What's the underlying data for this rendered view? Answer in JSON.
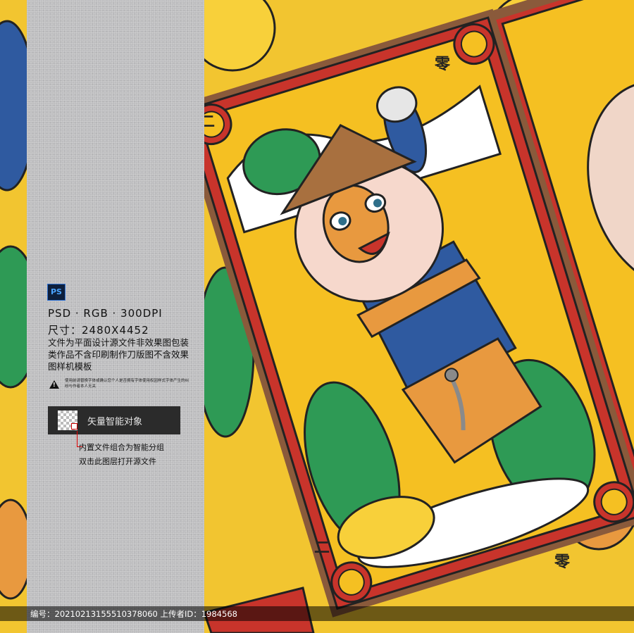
{
  "panel": {
    "format_icon": "PS",
    "spec_line": "PSD · RGB · 300DPI",
    "size_line": "尺寸：2480X4452",
    "description": "文件为平面设计源文件非效果图包装类作品不含印刷制作刀版图不含效果图样机模板",
    "warning": "使用前请替换字体或确认您个人是否拥有字体使用权因样式字体产生的纠纷与作者本人无关",
    "smart_object_label": "矢量智能对象",
    "note_line1": "内置文件组合为智能分组",
    "note_line2": "双击此图层打开源文件"
  },
  "footer": {
    "text": "编号：20210213155510378060 上传者ID：1984568"
  },
  "artwork": {
    "card_top_seal": "零",
    "card_left_seal": "二",
    "card_bottom_seal": "二",
    "card_bottom_right_seal": "零",
    "colors": {
      "red": "#c8342b",
      "yellow": "#f5c022",
      "blue": "#2f5aa0",
      "orange": "#e8993f",
      "green": "#2e9a55"
    }
  }
}
